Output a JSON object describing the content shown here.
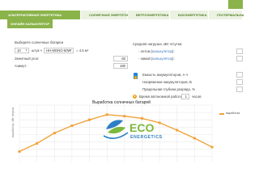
{
  "nav": {
    "items": [
      {
        "label": "АЛЬТЕРНАТИВНАЯ ЭНЕРГЕТИКА"
      },
      {
        "label": "СОЛНЕЧНАЯ ЭНЕРГЕТИКА"
      },
      {
        "label": "ВЕТРОЭНЕРГЕТИКА"
      },
      {
        "label": "БИОЭНЕРГЕТИКА"
      },
      {
        "label": "ГЕОТЕРМАЛЬНА"
      }
    ]
  },
  "calc_button": "ОНЛАЙН КАЛЬКУЛЯТОР",
  "left": {
    "panels_label": "Выберите солнечные батареи",
    "count_value": "10",
    "pieces_text": "штук ×",
    "model_value": "HH-MONO-50W",
    "area_text": "= 4.5 м²",
    "tilt_label": "Зенитный угол:",
    "tilt_value": "60",
    "azimuth_label": "Азимут:",
    "azimuth_value": "180"
  },
  "right": {
    "load_label": "Средняя нагрузка, кВт·ч/сутки:",
    "summer_prefix": "- летом (",
    "summer_link": "калькулятор",
    "summer_suffix": "):",
    "winter_prefix": "- зимой (",
    "winter_link": "калькулятор",
    "winter_suffix": "):",
    "capacity_label": "Емкость аккумуляторов, А·ч",
    "voltage_label": "Напряжение аккумуляторов, В",
    "discharge_label": "Предельная глубина разряда, %",
    "autonomy_label": "Время автономной работы:",
    "autonomy_value": "1",
    "autonomy_unit": "часов"
  },
  "chart_data": {
    "type": "line",
    "title": "Выработка солнечных батарей",
    "ylabel": "выработка, кВт·ч/сутки",
    "series": [
      {
        "name": "выработка",
        "color": "#f0a23b",
        "values": [
          2.7,
          3.8,
          5.2,
          6.2,
          7.0,
          7.7,
          7.5,
          7.2,
          6.6,
          5.6,
          4.5,
          3.3
        ]
      }
    ],
    "ylim": [
      0,
      9
    ],
    "grid": true,
    "legend": "top-right"
  },
  "watermark": {
    "eco": "ECO",
    "energetics": "ENERGETICS"
  }
}
